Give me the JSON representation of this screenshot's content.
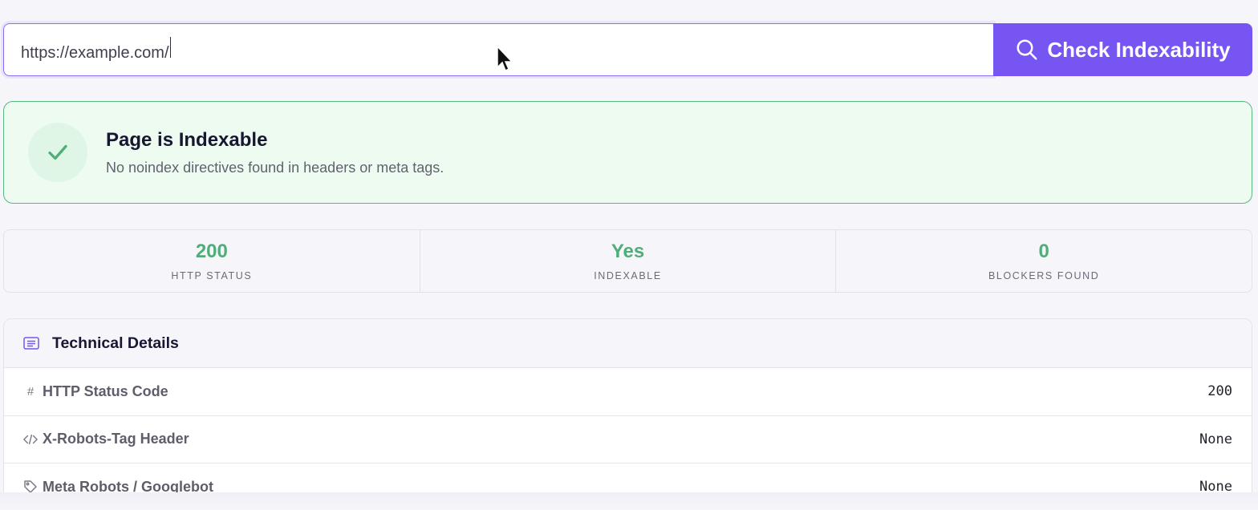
{
  "search": {
    "url_value": "https://example.com/",
    "button_label": "Check Indexability",
    "icon": "search-icon"
  },
  "result": {
    "title": "Page is Indexable",
    "subtitle": "No noindex directives found in headers or meta tags.",
    "icon": "check-icon",
    "status_color": "#4fae78"
  },
  "stats": [
    {
      "value": "200",
      "label": "HTTP STATUS"
    },
    {
      "value": "Yes",
      "label": "INDEXABLE"
    },
    {
      "value": "0",
      "label": "BLOCKERS FOUND"
    }
  ],
  "details": {
    "title": "Technical Details",
    "icon": "list-icon",
    "rows": [
      {
        "icon": "hash-icon",
        "label": "HTTP Status Code",
        "value": "200"
      },
      {
        "icon": "code-icon",
        "label": "X-Robots-Tag Header",
        "value": "None"
      },
      {
        "icon": "tag-icon",
        "label": "Meta Robots / Googlebot",
        "value": "None"
      }
    ]
  },
  "colors": {
    "accent": "#7655f3",
    "success": "#4fae78",
    "success_bg": "#eefbf1"
  }
}
